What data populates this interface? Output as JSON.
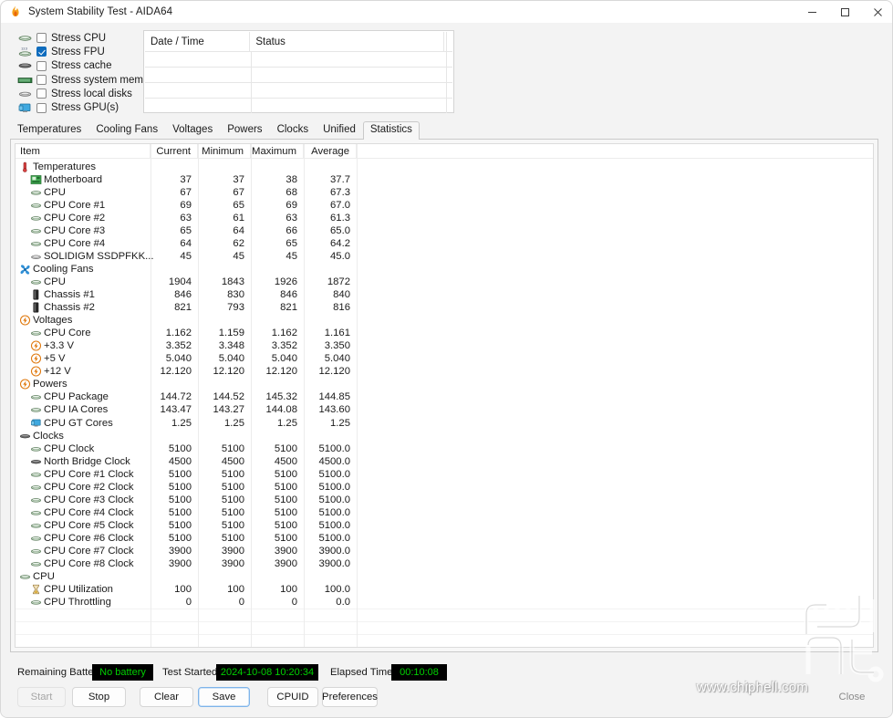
{
  "window": {
    "title": "System Stability Test - AIDA64",
    "app_icon": "flame-icon",
    "controls": {
      "minimize": "minimize-icon",
      "maximize": "maximize-icon",
      "close": "close-icon"
    }
  },
  "stress_options": [
    {
      "label": "Stress CPU",
      "checked": false,
      "icon": "cpu-icon"
    },
    {
      "label": "Stress FPU",
      "checked": true,
      "icon": "fpu-icon"
    },
    {
      "label": "Stress cache",
      "checked": false,
      "icon": "cache-icon"
    },
    {
      "label": "Stress system memory",
      "checked": false,
      "icon": "memory-icon"
    },
    {
      "label": "Stress local disks",
      "checked": false,
      "icon": "disk-icon"
    },
    {
      "label": "Stress GPU(s)",
      "checked": false,
      "icon": "gpu-icon"
    }
  ],
  "log": {
    "columns": [
      "Date / Time",
      "Status"
    ],
    "rows": []
  },
  "tabs": [
    {
      "label": "Temperatures",
      "active": false
    },
    {
      "label": "Cooling Fans",
      "active": false
    },
    {
      "label": "Voltages",
      "active": false
    },
    {
      "label": "Powers",
      "active": false
    },
    {
      "label": "Clocks",
      "active": false
    },
    {
      "label": "Unified",
      "active": false
    },
    {
      "label": "Statistics",
      "active": true
    }
  ],
  "statistics": {
    "columns": [
      "Item",
      "Current",
      "Minimum",
      "Maximum",
      "Average"
    ],
    "rows": [
      {
        "level": 0,
        "icon": "thermometer-icon",
        "label": "Temperatures",
        "current": "",
        "minimum": "",
        "maximum": "",
        "average": ""
      },
      {
        "level": 1,
        "icon": "motherboard-icon",
        "label": "Motherboard",
        "current": "37",
        "minimum": "37",
        "maximum": "38",
        "average": "37.7"
      },
      {
        "level": 1,
        "icon": "cpu-icon",
        "label": "CPU",
        "current": "67",
        "minimum": "67",
        "maximum": "68",
        "average": "67.3"
      },
      {
        "level": 1,
        "icon": "cpu-icon",
        "label": "CPU Core #1",
        "current": "69",
        "minimum": "65",
        "maximum": "69",
        "average": "67.0"
      },
      {
        "level": 1,
        "icon": "cpu-icon",
        "label": "CPU Core #2",
        "current": "63",
        "minimum": "61",
        "maximum": "63",
        "average": "61.3"
      },
      {
        "level": 1,
        "icon": "cpu-icon",
        "label": "CPU Core #3",
        "current": "65",
        "minimum": "64",
        "maximum": "66",
        "average": "65.0"
      },
      {
        "level": 1,
        "icon": "cpu-icon",
        "label": "CPU Core #4",
        "current": "64",
        "minimum": "62",
        "maximum": "65",
        "average": "64.2"
      },
      {
        "level": 1,
        "icon": "disk-icon",
        "label": "SOLIDIGM SSDPFKK...",
        "current": "45",
        "minimum": "45",
        "maximum": "45",
        "average": "45.0"
      },
      {
        "level": 0,
        "icon": "fan-icon",
        "label": "Cooling Fans",
        "current": "",
        "minimum": "",
        "maximum": "",
        "average": ""
      },
      {
        "level": 1,
        "icon": "cpu-icon",
        "label": "CPU",
        "current": "1904",
        "minimum": "1843",
        "maximum": "1926",
        "average": "1872"
      },
      {
        "level": 1,
        "icon": "chassis-icon",
        "label": "Chassis #1",
        "current": "846",
        "minimum": "830",
        "maximum": "846",
        "average": "840"
      },
      {
        "level": 1,
        "icon": "chassis-icon",
        "label": "Chassis #2",
        "current": "821",
        "minimum": "793",
        "maximum": "821",
        "average": "816"
      },
      {
        "level": 0,
        "icon": "voltage-icon",
        "label": "Voltages",
        "current": "",
        "minimum": "",
        "maximum": "",
        "average": ""
      },
      {
        "level": 1,
        "icon": "cpu-icon",
        "label": "CPU Core",
        "current": "1.162",
        "minimum": "1.159",
        "maximum": "1.162",
        "average": "1.161"
      },
      {
        "level": 1,
        "icon": "voltage-icon",
        "label": "+3.3 V",
        "current": "3.352",
        "minimum": "3.348",
        "maximum": "3.352",
        "average": "3.350"
      },
      {
        "level": 1,
        "icon": "voltage-icon",
        "label": "+5 V",
        "current": "5.040",
        "minimum": "5.040",
        "maximum": "5.040",
        "average": "5.040"
      },
      {
        "level": 1,
        "icon": "voltage-icon",
        "label": "+12 V",
        "current": "12.120",
        "minimum": "12.120",
        "maximum": "12.120",
        "average": "12.120"
      },
      {
        "level": 0,
        "icon": "voltage-icon",
        "label": "Powers",
        "current": "",
        "minimum": "",
        "maximum": "",
        "average": ""
      },
      {
        "level": 1,
        "icon": "cpu-icon",
        "label": "CPU Package",
        "current": "144.72",
        "minimum": "144.52",
        "maximum": "145.32",
        "average": "144.85"
      },
      {
        "level": 1,
        "icon": "cpu-icon",
        "label": "CPU IA Cores",
        "current": "143.47",
        "minimum": "143.27",
        "maximum": "144.08",
        "average": "143.60"
      },
      {
        "level": 1,
        "icon": "gpu-icon",
        "label": "CPU GT Cores",
        "current": "1.25",
        "minimum": "1.25",
        "maximum": "1.25",
        "average": "1.25"
      },
      {
        "level": 0,
        "icon": "cache-icon",
        "label": "Clocks",
        "current": "",
        "minimum": "",
        "maximum": "",
        "average": ""
      },
      {
        "level": 1,
        "icon": "cpu-icon",
        "label": "CPU Clock",
        "current": "5100",
        "minimum": "5100",
        "maximum": "5100",
        "average": "5100.0"
      },
      {
        "level": 1,
        "icon": "cache-icon",
        "label": "North Bridge Clock",
        "current": "4500",
        "minimum": "4500",
        "maximum": "4500",
        "average": "4500.0"
      },
      {
        "level": 1,
        "icon": "cpu-icon",
        "label": "CPU Core #1 Clock",
        "current": "5100",
        "minimum": "5100",
        "maximum": "5100",
        "average": "5100.0"
      },
      {
        "level": 1,
        "icon": "cpu-icon",
        "label": "CPU Core #2 Clock",
        "current": "5100",
        "minimum": "5100",
        "maximum": "5100",
        "average": "5100.0"
      },
      {
        "level": 1,
        "icon": "cpu-icon",
        "label": "CPU Core #3 Clock",
        "current": "5100",
        "minimum": "5100",
        "maximum": "5100",
        "average": "5100.0"
      },
      {
        "level": 1,
        "icon": "cpu-icon",
        "label": "CPU Core #4 Clock",
        "current": "5100",
        "minimum": "5100",
        "maximum": "5100",
        "average": "5100.0"
      },
      {
        "level": 1,
        "icon": "cpu-icon",
        "label": "CPU Core #5 Clock",
        "current": "5100",
        "minimum": "5100",
        "maximum": "5100",
        "average": "5100.0"
      },
      {
        "level": 1,
        "icon": "cpu-icon",
        "label": "CPU Core #6 Clock",
        "current": "5100",
        "minimum": "5100",
        "maximum": "5100",
        "average": "5100.0"
      },
      {
        "level": 1,
        "icon": "cpu-icon",
        "label": "CPU Core #7 Clock",
        "current": "3900",
        "minimum": "3900",
        "maximum": "3900",
        "average": "3900.0"
      },
      {
        "level": 1,
        "icon": "cpu-icon",
        "label": "CPU Core #8 Clock",
        "current": "3900",
        "minimum": "3900",
        "maximum": "3900",
        "average": "3900.0"
      },
      {
        "level": 0,
        "icon": "cpu-icon",
        "label": "CPU",
        "current": "",
        "minimum": "",
        "maximum": "",
        "average": ""
      },
      {
        "level": 1,
        "icon": "hourglass-icon",
        "label": "CPU Utilization",
        "current": "100",
        "minimum": "100",
        "maximum": "100",
        "average": "100.0"
      },
      {
        "level": 1,
        "icon": "cpu-icon",
        "label": "CPU Throttling",
        "current": "0",
        "minimum": "0",
        "maximum": "0",
        "average": "0.0"
      }
    ]
  },
  "footer": {
    "battery_label": "Remaining Battery:",
    "battery_value": "No battery",
    "started_label": "Test Started:",
    "started_value": "2024-10-08 10:20:34",
    "elapsed_label": "Elapsed Time:",
    "elapsed_value": "00:10:08",
    "buttons": [
      {
        "label": "Start",
        "state": "disabled"
      },
      {
        "label": "Stop",
        "state": "normal"
      },
      {
        "label": "Clear",
        "state": "normal"
      },
      {
        "label": "Save",
        "state": "focused"
      },
      {
        "label": "CPUID",
        "state": "normal"
      },
      {
        "label": "Preferences",
        "state": "normal"
      },
      {
        "label": "Close",
        "state": "ghost"
      }
    ]
  },
  "watermark": {
    "text": "www.chiphell.com",
    "logo": "chiphell-logo"
  },
  "colors": {
    "accent": "#0f6cbd",
    "status_text": "#00d000",
    "status_bg": "#000000",
    "panel_bg": "#f3f3f3",
    "grid_bg": "#ffffff"
  }
}
